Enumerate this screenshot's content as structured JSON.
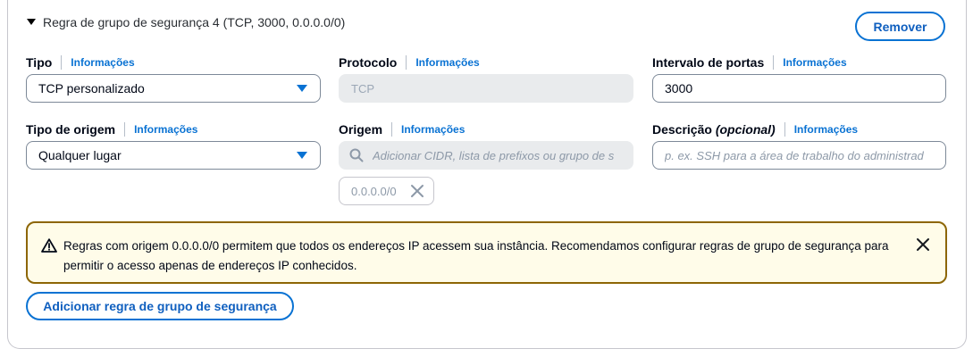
{
  "rule": {
    "title": "Regra de grupo de segurança 4 (TCP, 3000, 0.0.0.0/0)",
    "remove_label": "Remover"
  },
  "info_link": "Informações",
  "fields": {
    "tipo": {
      "label": "Tipo",
      "value": "TCP personalizado"
    },
    "protocolo": {
      "label": "Protocolo",
      "value": "TCP"
    },
    "intervalo": {
      "label": "Intervalo de portas",
      "value": "3000"
    },
    "tipo_origem": {
      "label": "Tipo de origem",
      "value": "Qualquer lugar"
    },
    "origem": {
      "label": "Origem",
      "placeholder": "Adicionar CIDR, lista de prefixos ou grupo de s",
      "token": "0.0.0.0/0"
    },
    "descricao": {
      "label": "Descrição",
      "label_optional": "(opcional)",
      "placeholder": "p. ex. SSH para a área de trabalho do administrad"
    }
  },
  "alert": {
    "message": "Regras com origem 0.0.0.0/0 permitem que todos os endereços IP acessem sua instância. Recomendamos configurar regras de grupo de segurança para permitir o acesso apenas de endereços IP conhecidos."
  },
  "add_rule_label": "Adicionar regra de grupo de segurança",
  "colors": {
    "accent": "#0972d3",
    "warning_border": "#8d6605",
    "warning_bg": "#fffce9"
  },
  "icons": [
    "caret-down-icon",
    "dropdown-arrow-icon",
    "search-icon",
    "close-icon",
    "warning-icon"
  ]
}
